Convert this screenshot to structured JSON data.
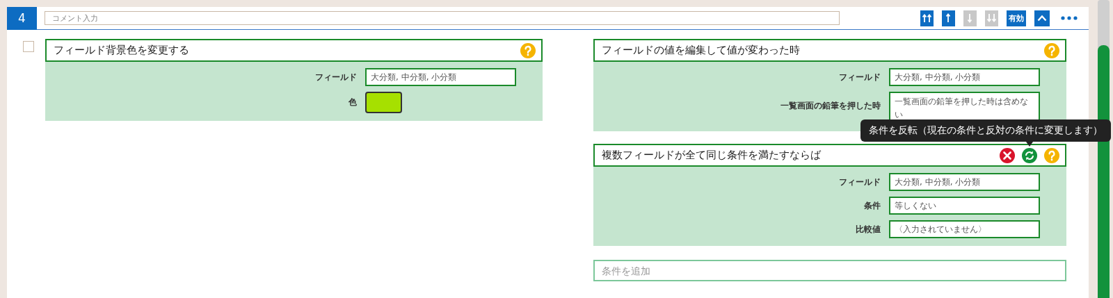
{
  "header": {
    "number": "4",
    "comment": {
      "placeholder": "コメント入力"
    },
    "toolbar": [
      {
        "kind": "top",
        "disabled": false
      },
      {
        "kind": "up",
        "disabled": false
      },
      {
        "kind": "down",
        "disabled": true
      },
      {
        "kind": "bottom",
        "disabled": true
      },
      {
        "kind": "toggle",
        "label": "有効",
        "disabled": false
      },
      {
        "kind": "collapse",
        "disabled": false
      },
      {
        "kind": "more",
        "disabled": false
      }
    ]
  },
  "checkbox": {
    "checked": false
  },
  "action": {
    "title": "フィールド背景色を変更する",
    "fields": [
      {
        "kind": "text",
        "label": "フィールド",
        "value": "大分類, 中分類, 小分類"
      },
      {
        "kind": "color",
        "label": "色",
        "color": "#a6e000"
      }
    ]
  },
  "trigger": {
    "title": "フィールドの値を編集して値が変わった時",
    "fields": [
      {
        "kind": "text",
        "label": "フィールド",
        "value": "大分類, 中分類, 小分類"
      },
      {
        "kind": "textarea",
        "label": "一覧画面の鉛筆を押した時",
        "value": "一覧画面の鉛筆を押した時は含めない"
      }
    ]
  },
  "conditions": [
    {
      "title": "複数フィールドが全て同じ条件を満たすならば",
      "tooltip": "条件を反転（現在の条件と反対の条件に変更します）",
      "fields": [
        {
          "kind": "text",
          "label": "フィールド",
          "value": "大分類, 中分類, 小分類"
        },
        {
          "kind": "text",
          "label": "条件",
          "value": "等しくない"
        },
        {
          "kind": "text",
          "label": "比較値",
          "value": "〈入力されていません〉"
        }
      ]
    }
  ],
  "add_condition": {
    "placeholder": "条件を追加"
  }
}
